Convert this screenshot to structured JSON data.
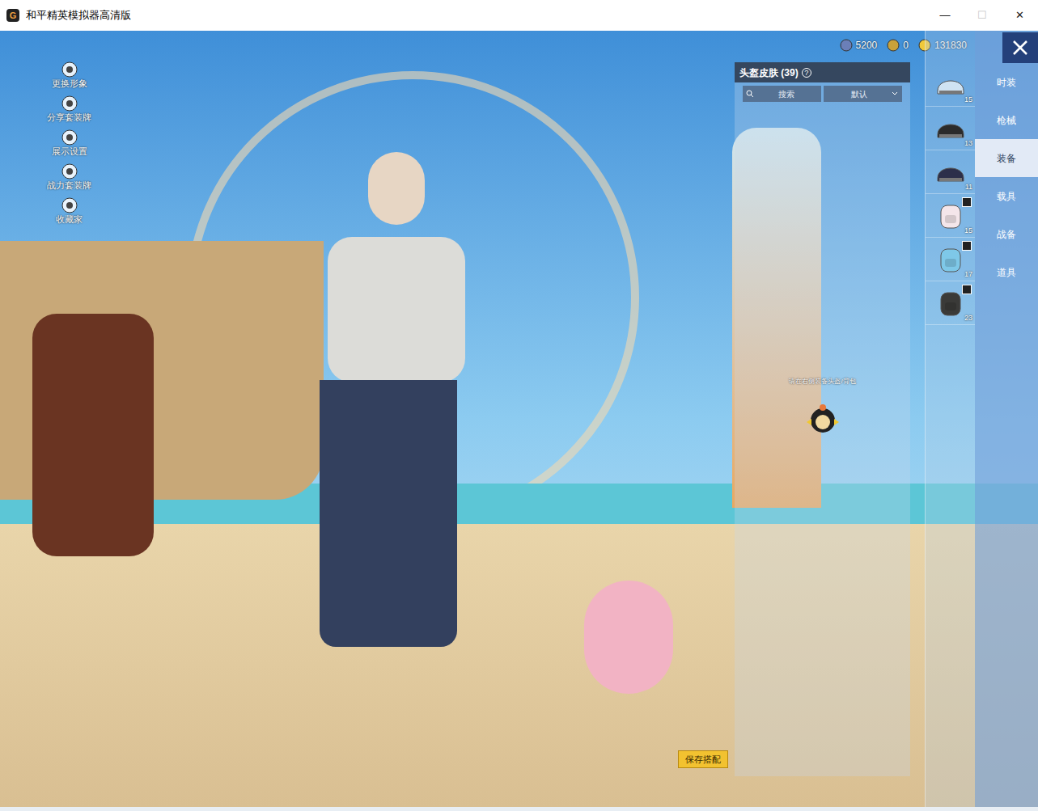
{
  "window": {
    "title": "和平精英模拟器高清版",
    "logo": "G",
    "controls": [
      {
        "label": "—",
        "disabled": false
      },
      {
        "label": "☐",
        "disabled": true
      },
      {
        "label": "✕",
        "disabled": false
      }
    ]
  },
  "side_menu": [
    {
      "label": "更换形象"
    },
    {
      "label": "分享套装牌"
    },
    {
      "label": "展示设置"
    },
    {
      "label": "战力套装牌"
    },
    {
      "label": "收藏家"
    }
  ],
  "currencies": [
    {
      "amount": "5200",
      "color": "#6b7fb8"
    },
    {
      "amount": "0",
      "color": "#c9a23a"
    },
    {
      "amount": "131830",
      "color": "#f0c93a"
    }
  ],
  "panel": {
    "title": "头盔皮肤 (39)",
    "help": "?",
    "search_placeholder": "搜索",
    "sort": "默认",
    "hint": "请在右侧装备头盔/背包"
  },
  "slots": [
    {
      "kind": "helmet",
      "level": "15",
      "badge": false,
      "color": "#cfe3f2"
    },
    {
      "kind": "helmet",
      "level": "13",
      "badge": false,
      "color": "#2b2b2b"
    },
    {
      "kind": "helmet",
      "level": "11",
      "badge": false,
      "color": "#2c2f4a"
    },
    {
      "kind": "backpack",
      "level": "15",
      "badge": true,
      "color": "#f4e6ea"
    },
    {
      "kind": "backpack",
      "level": "17",
      "badge": true,
      "color": "#7ec8e8"
    },
    {
      "kind": "backpack",
      "level": "23",
      "badge": true,
      "color": "#3a3a38"
    }
  ],
  "tabs": [
    {
      "label": "时装",
      "selected": false
    },
    {
      "label": "枪械",
      "selected": false
    },
    {
      "label": "装备",
      "selected": true
    },
    {
      "label": "载具",
      "selected": false
    },
    {
      "label": "战备",
      "selected": false
    },
    {
      "label": "道具",
      "selected": false
    }
  ],
  "save_button": "保存搭配"
}
